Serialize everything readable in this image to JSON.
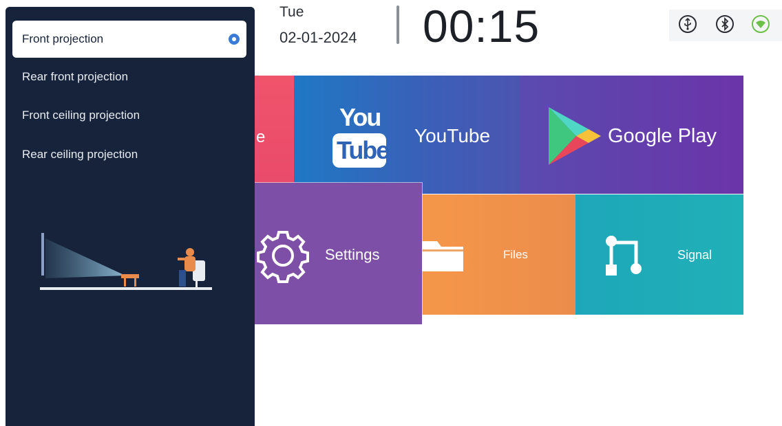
{
  "status_bar": {
    "day": "Tue",
    "date": "02-01-2024",
    "time": "00:15",
    "icons": [
      "usb-icon",
      "bluetooth-icon",
      "wifi-icon"
    ],
    "wifi_color": "#6cc04a"
  },
  "tiles": {
    "partial_label": "e",
    "youtube": {
      "logo_top": "You",
      "logo_bottom": "Tube",
      "label": "YouTube"
    },
    "google_play": {
      "label": "Google Play"
    },
    "settings": {
      "label": "Settings"
    },
    "files": {
      "label": "Files"
    },
    "signal": {
      "label": "Signal"
    }
  },
  "projection_menu": {
    "options": [
      {
        "label": "Front projection",
        "selected": true
      },
      {
        "label": "Rear front projection",
        "selected": false
      },
      {
        "label": "Front ceiling projection",
        "selected": false
      },
      {
        "label": "Rear ceiling projection",
        "selected": false
      }
    ],
    "illustration": "front-projection-illustration"
  },
  "colors": {
    "panel_bg": "#17233a",
    "selection_accent": "#3a7bd5",
    "tile_red": "#f0546b",
    "tile_youtube": "#2f63b6",
    "tile_play": "#6b34a8",
    "tile_settings": "#7d4fa7",
    "tile_files": "#f5974a",
    "tile_signal": "#1ea7b9"
  }
}
